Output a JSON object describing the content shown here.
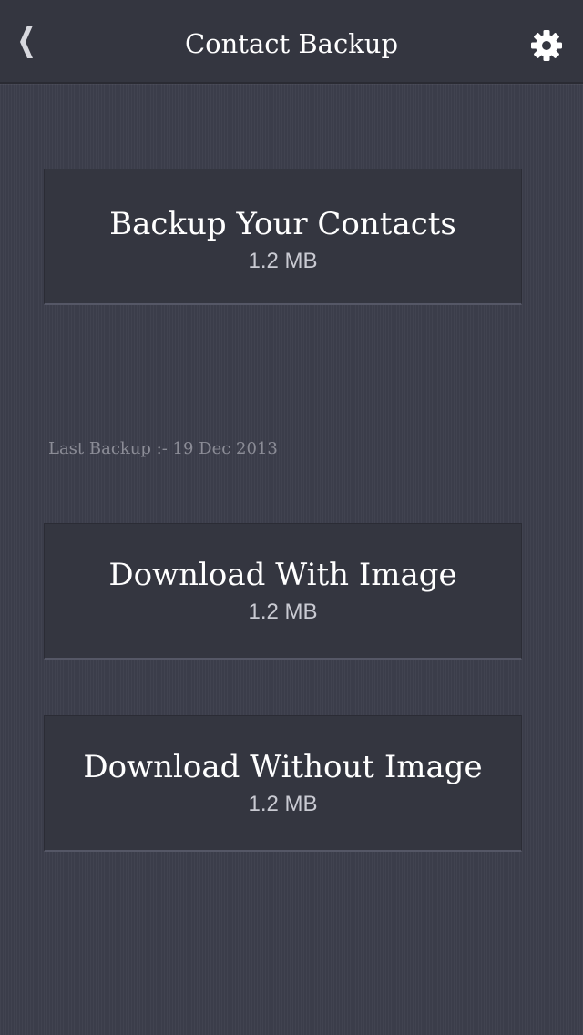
{
  "nav": {
    "title": "Contact Backup",
    "back_icon": "chevron-left-icon",
    "settings_icon": "gear-icon"
  },
  "backup_card": {
    "title": "Backup Your Contacts",
    "size": "1.2 MB"
  },
  "last_backup": "Last Backup :- 19 Dec 2013",
  "download_with_image": {
    "title": "Download With Image",
    "size": "1.2 MB"
  },
  "download_without_image": {
    "title": "Download Without Image",
    "size": "1.2 MB"
  },
  "colors": {
    "background": "#3d3f4c",
    "bar": "#343640",
    "card": "#343640",
    "text": "#ffffff",
    "muted_text": "#8b8c96"
  }
}
